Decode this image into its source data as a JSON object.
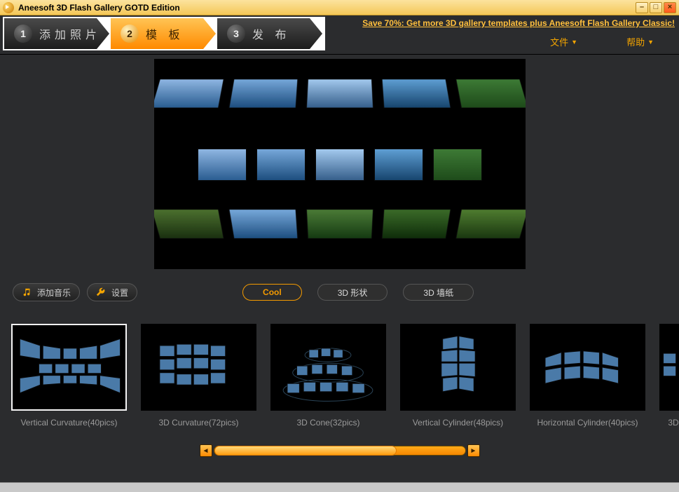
{
  "app_title": "Aneesoft 3D Flash Gallery GOTD Edition",
  "window_buttons": {
    "min": "–",
    "max": "□",
    "close": "×"
  },
  "steps": [
    {
      "num": "1",
      "label": "添加照片"
    },
    {
      "num": "2",
      "label": "模  板"
    },
    {
      "num": "3",
      "label": "发  布"
    }
  ],
  "promo": "Save 70%:  Get more 3D gallery templates plus Aneesoft Flash Gallery Classic!",
  "menus": {
    "file": "文件",
    "help": "帮助"
  },
  "buttons": {
    "add_music": "添加音乐",
    "settings": "设置"
  },
  "tabs": [
    {
      "label": "Cool",
      "active": true
    },
    {
      "label": "3D 形状",
      "active": false
    },
    {
      "label": "3D 墙纸",
      "active": false
    }
  ],
  "templates": [
    {
      "label": "Vertical Curvature(40pics)",
      "selected": true,
      "shape": "vcurve"
    },
    {
      "label": "3D Curvature(72pics)",
      "selected": false,
      "shape": "curvewall"
    },
    {
      "label": "3D Cone(32pics)",
      "selected": false,
      "shape": "cone"
    },
    {
      "label": "Vertical Cylinder(48pics)",
      "selected": false,
      "shape": "vcyl"
    },
    {
      "label": "Horizontal Cylinder(40pics)",
      "selected": false,
      "shape": "hcyl"
    },
    {
      "label": "3D",
      "selected": false,
      "shape": "cut"
    }
  ],
  "scroll": {
    "left": "◄",
    "right": "►"
  }
}
